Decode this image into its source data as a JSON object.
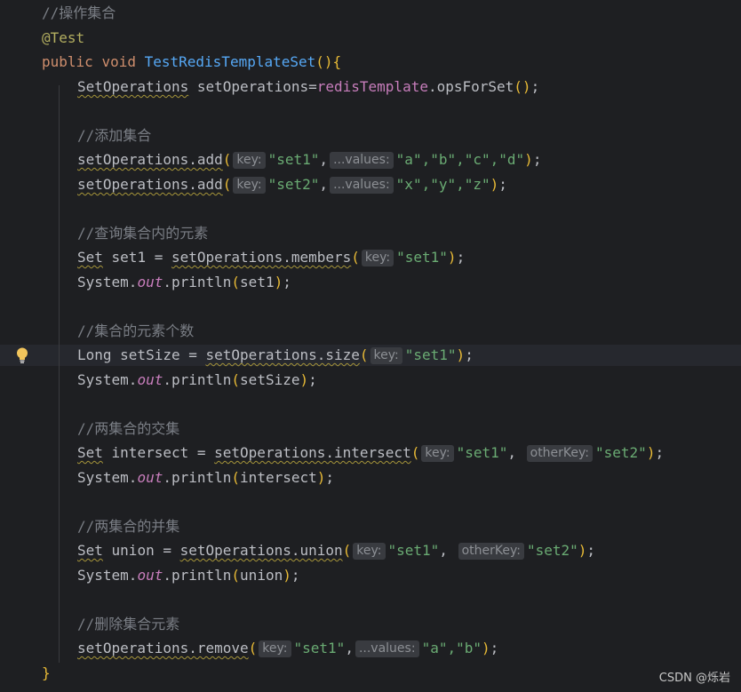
{
  "editor": {
    "lines": {
      "l1_comment": "//操作集合",
      "l2_annotation": "@Test",
      "l3_public": "public",
      "l3_void": "void",
      "l3_name": "TestRedisTemplateSet",
      "l3_open": "()",
      "l3_brace": "{",
      "l4_type": "SetOperations",
      "l4_var": " setOperations=",
      "l4_field": "redisTemplate",
      "l4_call": ".opsForSet",
      "l4_parens": "()",
      "l4_end": ";",
      "l6_comment": "//添加集合",
      "l7_obj": "setOperations.add",
      "l7_hint_key": "key:",
      "l7_arg1": "\"set1\"",
      "l7_comma": ",",
      "l7_hint_values": "...values:",
      "l7_args": "\"a\",\"b\",\"c\",\"d\"",
      "l7_end": ";",
      "l8_obj": "setOperations.add",
      "l8_hint_key": "key:",
      "l8_arg1": "\"set2\"",
      "l8_comma": ",",
      "l8_hint_values": "...values:",
      "l8_args": "\"x\",\"y\",\"z\"",
      "l8_end": ";",
      "l10_comment": "//查询集合内的元素",
      "l11_type": "Set",
      "l11_decl": " set1 = ",
      "l11_call": "setOperations.members",
      "l11_hint_key": "key:",
      "l11_arg": "\"set1\"",
      "l11_end": ";",
      "l12_system": "System.",
      "l12_out": "out",
      "l12_println": ".println",
      "l12_arg": "set1",
      "l12_end": ";",
      "l14_comment": "//集合的元素个数",
      "l15_decl": "Long setSize = ",
      "l15_call": "setOperations.size",
      "l15_hint_key": "key:",
      "l15_arg": "\"set1\"",
      "l15_end": ";",
      "l16_system": "System.",
      "l16_out": "out",
      "l16_println": ".println",
      "l16_arg": "setSize",
      "l16_end": ";",
      "l18_comment": "//两集合的交集",
      "l19_type": "Set",
      "l19_decl": " intersect = ",
      "l19_call": "setOperations.intersect",
      "l19_hint_key": "key:",
      "l19_arg1": "\"set1\"",
      "l19_comma": ", ",
      "l19_hint_other": "otherKey:",
      "l19_arg2": "\"set2\"",
      "l19_end": ";",
      "l20_system": "System.",
      "l20_out": "out",
      "l20_println": ".println",
      "l20_arg": "intersect",
      "l20_end": ";",
      "l22_comment": "//两集合的并集",
      "l23_type": "Set",
      "l23_decl": " union = ",
      "l23_call": "setOperations.union",
      "l23_hint_key": "key:",
      "l23_arg1": "\"set1\"",
      "l23_comma": ", ",
      "l23_hint_other": "otherKey:",
      "l23_arg2": "\"set2\"",
      "l23_end": ";",
      "l24_system": "System.",
      "l24_out": "out",
      "l24_println": ".println",
      "l24_arg": "union",
      "l24_end": ";",
      "l26_comment": "//删除集合元素",
      "l27_call": "setOperations.remove",
      "l27_hint_key": "key:",
      "l27_arg1": "\"set1\"",
      "l27_comma": ",",
      "l27_hint_values": "...values:",
      "l27_args": "\"a\",\"b\"",
      "l27_end": ";",
      "l28_brace": "}"
    },
    "gutter_icon": "lightbulb-icon",
    "colors": {
      "background": "#1e1f22",
      "keyword": "#cf8e6d",
      "string": "#6aab73",
      "comment": "#7a7e85",
      "method_declaration": "#56a8f5",
      "field": "#c77dbb",
      "annotation": "#b3ae60",
      "bracket": "#e8ba36"
    }
  },
  "watermark": "CSDN @烁岩"
}
